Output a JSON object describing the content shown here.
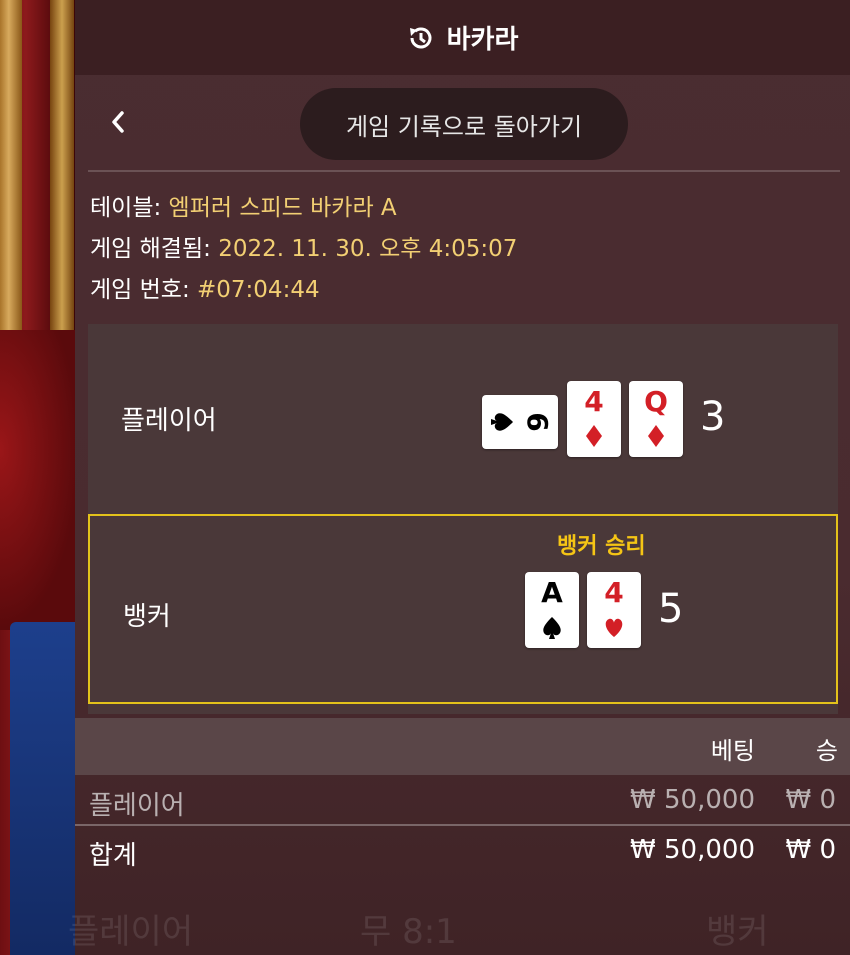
{
  "header": {
    "title": "바카라",
    "icon": "history-icon"
  },
  "nav": {
    "back_icon": "chevron-left-icon",
    "back_label": "게임 기록으로 돌아가기"
  },
  "info": {
    "table_label": "테이블:",
    "table_value": "엠퍼러 스피드 바카라 A",
    "resolved_label": "게임 해결됨:",
    "resolved_value": "2022. 11. 30. 오후 4:05:07",
    "number_label": "게임 번호:",
    "number_value": "#07:04:44"
  },
  "player": {
    "label": "플레이어",
    "score": "3",
    "cards": [
      {
        "rank": "6",
        "suit": "spade",
        "color": "#000000",
        "rotated": true
      },
      {
        "rank": "4",
        "suit": "diamond",
        "color": "#d31f26",
        "rotated": false
      },
      {
        "rank": "Q",
        "suit": "diamond",
        "color": "#d31f26",
        "rotated": false
      }
    ]
  },
  "banker": {
    "label": "뱅커",
    "score": "5",
    "winner_text": "뱅커 승리",
    "cards": [
      {
        "rank": "A",
        "suit": "spade",
        "color": "#000000",
        "rotated": false
      },
      {
        "rank": "4",
        "suit": "heart",
        "color": "#d31f26",
        "rotated": false
      }
    ]
  },
  "bets": {
    "col_bet": "베팅",
    "col_win": "승",
    "rows": [
      {
        "name": "플레이어",
        "bet": "₩ 50,000",
        "win": "₩ 0"
      }
    ],
    "total": {
      "name": "합계",
      "bet": "₩ 50,000",
      "win": "₩ 0"
    }
  },
  "background_buttons": [
    "플레이어",
    "무 8:1",
    "뱅커"
  ],
  "colors": {
    "accent_gold": "#f2cf73",
    "winner_yellow": "#f5c515",
    "card_red": "#d31f26"
  }
}
